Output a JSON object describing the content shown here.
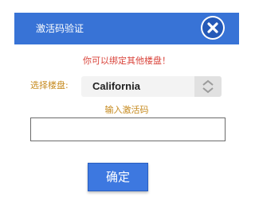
{
  "dialog": {
    "title": "激活码验证",
    "close_icon": "close-icon",
    "header_color": "#3873d6"
  },
  "hint": {
    "text": "你可以绑定其他楼盘！",
    "color": "#d9433a"
  },
  "property_select": {
    "label": "选择楼盘:",
    "selected_value": "California",
    "stepper_icon": "chevron-up-down-icon"
  },
  "activation_code": {
    "label": "输入激活码",
    "value": ""
  },
  "confirm_button": {
    "label": "确定",
    "color": "#3d78e0"
  }
}
